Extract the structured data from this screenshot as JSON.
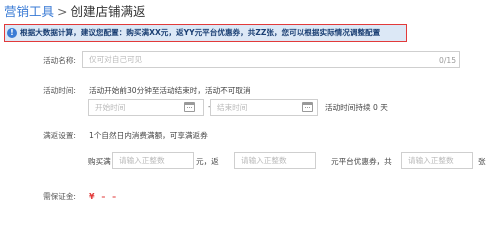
{
  "breadcrumb": {
    "root": "营销工具",
    "separator": ">",
    "current": "创建店铺满返"
  },
  "notice": {
    "text": "根据大数据计算，建议您配置：购买满XX元，返YY元平台优惠券，共ZZ张，您可以根据实际情况调整配置"
  },
  "form": {
    "activity_name": {
      "label": "活动名称:",
      "placeholder": "仅可对自己可见",
      "counter": "0/15"
    },
    "activity_time": {
      "label": "活动时间:",
      "hint": "活动开始前30分钟至活动结束时，活动不可取消",
      "start_placeholder": "开始时间",
      "separator": "-",
      "end_placeholder": "结束时间",
      "duration_text": "活动时间持续 0 天"
    },
    "rebate": {
      "label": "满返设置:",
      "hint": "1个自然日内消费满额，可享满返券",
      "buy_prefix": "购买满",
      "amount_placeholder": "请输入正整数",
      "yuan_return": "元，返",
      "return_placeholder": "请输入正整数",
      "coupon_text": "元平台优惠券，共",
      "count_placeholder": "请输入正整数",
      "unit": "张"
    },
    "deposit": {
      "label": "需保证金:",
      "value": "¥ – –"
    }
  },
  "colors": {
    "accent": "#3a7bd5",
    "notice_border": "#e23a3a",
    "notice_bg": "#dce8f6",
    "required": "#e23a3a"
  }
}
